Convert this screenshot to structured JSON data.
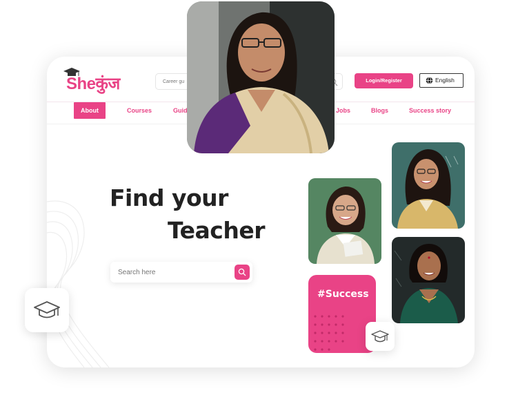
{
  "header": {
    "logo_text": "Sheकुंज",
    "search_placeholder": "Career gu",
    "login_label": "Login/Register",
    "language_label": "English"
  },
  "nav": {
    "items": [
      {
        "label": "About",
        "active": true
      },
      {
        "label": "Courses"
      },
      {
        "label": "Guid"
      },
      {
        "label": "Jobs"
      },
      {
        "label": "Blogs"
      },
      {
        "label": "Success story"
      }
    ]
  },
  "hero": {
    "title_line1": "Find your",
    "title_line2": "Teacher",
    "search_placeholder": "Search here"
  },
  "success_card": {
    "text": "#Success"
  },
  "colors": {
    "accent": "#e94386",
    "text_dark": "#222222",
    "background": "#ffffff"
  },
  "icons": [
    "graduation-cap-icon",
    "search-icon",
    "globe-icon"
  ]
}
